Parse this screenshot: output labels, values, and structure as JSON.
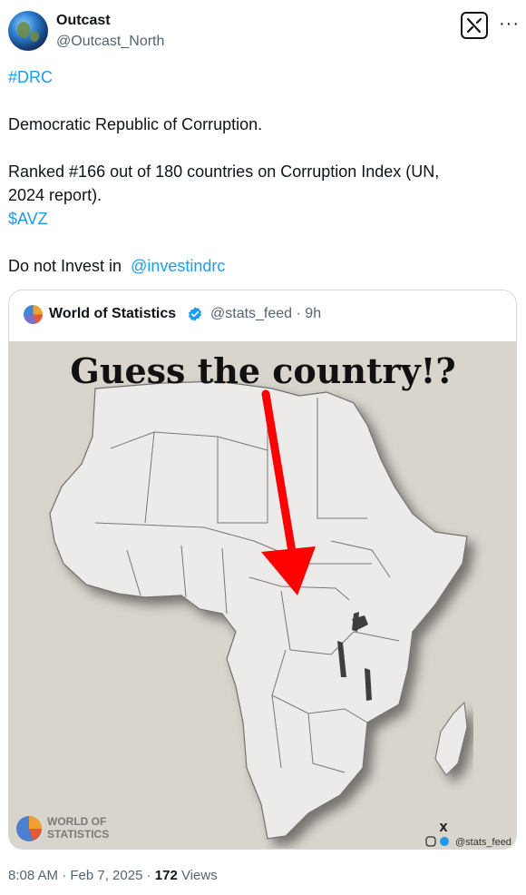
{
  "author": {
    "name": "Outcast",
    "handle": "@Outcast_North"
  },
  "post": {
    "hashtag": "#DRC",
    "line1": "Democratic Republic of Corruption.",
    "line2": "Ranked #166 out of 180 countries on Corruption Index (UN,",
    "line3": "2024 report).",
    "cashtag": "$AVZ",
    "line4": "Do not Invest in",
    "mention": "@investindrc"
  },
  "quote": {
    "name": "World of Statistics",
    "handle_time": "@stats_feed · 9h",
    "image": {
      "title": "Guess the country!?",
      "logo_line1": "WORLD OF",
      "logo_line2": "STATISTICS",
      "watermark_x": "X",
      "watermark_handle": "@stats_feed"
    }
  },
  "meta": {
    "time": "8:08 AM · Feb 7, 2025 · ",
    "views_count": "172",
    "views_label": " Views"
  },
  "colors": {
    "link": "#1d9bf0",
    "verified": "#1d9bf0",
    "arrow": "#ff0000",
    "secondary_text": "#536471"
  },
  "icons": [
    "grok-icon",
    "more-icon",
    "verified-badge-icon"
  ]
}
